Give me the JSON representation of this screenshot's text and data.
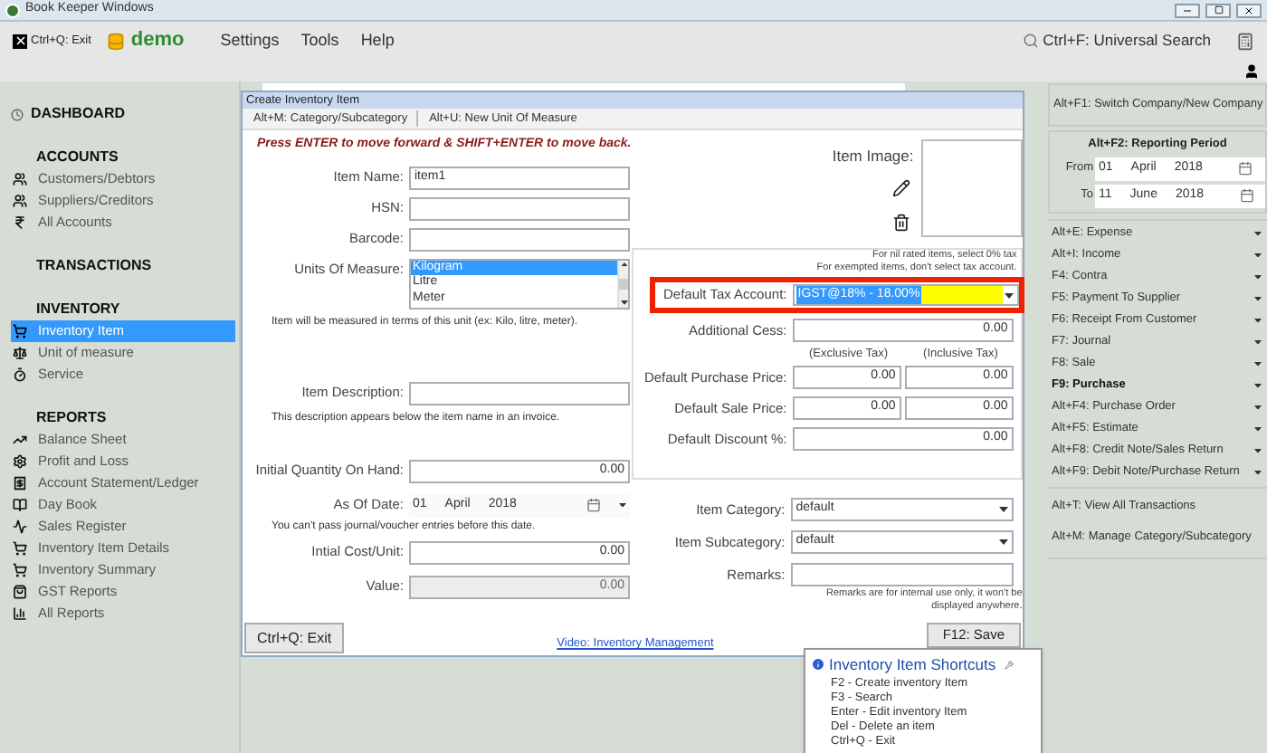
{
  "window": {
    "title": "Book Keeper Windows"
  },
  "menu_bar": {
    "exit": "Ctrl+Q: Exit",
    "company": "demo",
    "items": [
      "Settings",
      "Tools",
      "Help"
    ],
    "search": "Ctrl+F: Universal Search"
  },
  "sidebar": {
    "dashboard": "DASHBOARD",
    "sections": [
      {
        "title": "ACCOUNTS",
        "items": [
          {
            "label": "Customers/Debtors",
            "selected": false
          },
          {
            "label": "Suppliers/Creditors",
            "selected": false
          },
          {
            "label": "All Accounts",
            "selected": false
          }
        ]
      },
      {
        "title": "TRANSACTIONS"
      },
      {
        "title": "INVENTORY",
        "items": [
          {
            "label": "Inventory Item",
            "selected": true
          },
          {
            "label": "Unit of measure",
            "selected": false
          },
          {
            "label": "Service",
            "selected": false
          }
        ]
      },
      {
        "title": "REPORTS",
        "items": [
          {
            "label": "Balance Sheet",
            "selected": false
          },
          {
            "label": "Profit and Loss",
            "selected": false
          },
          {
            "label": "Account Statement/Ledger",
            "selected": false
          },
          {
            "label": "Day Book",
            "selected": false
          },
          {
            "label": "Sales Register",
            "selected": false
          },
          {
            "label": "Inventory Item Details",
            "selected": false
          },
          {
            "label": "Inventory Summary",
            "selected": false
          },
          {
            "label": "GST Reports",
            "selected": false
          },
          {
            "label": "All Reports",
            "selected": false
          }
        ]
      }
    ]
  },
  "dialog": {
    "title": "Create Inventory Item",
    "toolbar": [
      "Alt+M: Category/Subcategory",
      "Alt+U: New Unit Of Measure"
    ],
    "hint": "Press ENTER to move forward & SHIFT+ENTER to move back.",
    "item_name": {
      "label": "Item Name:",
      "value": "item1"
    },
    "hsn": {
      "label": "HSN:"
    },
    "barcode": {
      "label": "Barcode:"
    },
    "units": {
      "label": "Units Of Measure:",
      "options": [
        {
          "label": "Kilogram",
          "selected": true
        },
        {
          "label": "Litre",
          "selected": false
        },
        {
          "label": "Meter",
          "selected": false
        }
      ],
      "note": "Item will be measured in terms of this unit (ex: Kilo, litre, meter)."
    },
    "description": {
      "label": "Item Description:",
      "note": "This description appears below the item name in an invoice."
    },
    "initial_quantity": {
      "label": "Initial Quantity On Hand:",
      "value": "0.00"
    },
    "as_of_date": {
      "label": "As Of Date:",
      "day": "01",
      "month": "April",
      "year": "2018",
      "note": "You can't pass journal/voucher entries before this date."
    },
    "initial_cost": {
      "label": "Intial Cost/Unit:",
      "value": "0.00"
    },
    "value": {
      "label": "Value:",
      "value": "0.00",
      "disabled": true
    },
    "item_image": {
      "label": "Item Image:"
    },
    "tax": {
      "notes": [
        "For nil rated items, select 0% tax",
        "For exempted items, don't select tax account."
      ],
      "label": "Default Tax Account:",
      "value": "IGST@18% - 18.00%",
      "highlighted": true
    },
    "additional_cess": {
      "label": "Additional Cess:",
      "value": "0.00"
    },
    "price_headers": [
      "(Exclusive Tax)",
      "(Inclusive Tax)"
    ],
    "purchase_price": {
      "label": "Default Purchase Price:",
      "values": [
        "0.00",
        "0.00"
      ]
    },
    "sale_price": {
      "label": "Default Sale Price:",
      "values": [
        "0.00",
        "0.00"
      ]
    },
    "discount": {
      "label": "Default Discount %:",
      "value": "0.00"
    },
    "category": {
      "label": "Item Category:",
      "value": "default"
    },
    "subcategory": {
      "label": "Item Subcategory:",
      "value": "default"
    },
    "remarks": {
      "label": "Remarks:",
      "note": "Remarks are for internal use only, it won't be displayed anywhere."
    },
    "exit_button": "Ctrl+Q: Exit",
    "video_link": "Video: Inventory Management",
    "save_button": "F12: Save"
  },
  "shortcuts_popup": {
    "title": "Inventory Item Shortcuts",
    "lines": [
      "F2 - Create inventory Item",
      "F3 - Search",
      "Enter - Edit inventory Item",
      "Del - Delete an item",
      "Ctrl+Q - Exit"
    ]
  },
  "right_panel": {
    "switch_company": "Alt+F1: Switch Company/New Company",
    "reporting_period": {
      "title": "Alt+F2: Reporting Period",
      "from": {
        "label": "From",
        "day": "01",
        "month": "April",
        "year": "2018"
      },
      "to": {
        "label": "To",
        "day": "11",
        "month": "June",
        "year": "2018"
      }
    },
    "actions": [
      {
        "label": "Alt+E: Expense",
        "selected": false
      },
      {
        "label": "Alt+I: Income",
        "selected": false
      },
      {
        "label": "F4: Contra",
        "selected": false
      },
      {
        "label": "F5: Payment To Supplier",
        "selected": false
      },
      {
        "label": "F6: Receipt From Customer",
        "selected": false
      },
      {
        "label": "F7: Journal",
        "selected": false
      },
      {
        "label": "F8: Sale",
        "selected": false
      },
      {
        "label": "F9: Purchase",
        "selected": true
      },
      {
        "label": "Alt+F4: Purchase Order",
        "selected": false
      },
      {
        "label": "Alt+F5: Estimate",
        "selected": false
      },
      {
        "label": "Alt+F8: Credit Note/Sales Return",
        "selected": false
      },
      {
        "label": "Alt+F9: Debit Note/Purchase Return",
        "selected": false
      }
    ],
    "links": [
      "Alt+T: View All Transactions",
      "Alt+M: Manage Category/Subcategory"
    ]
  }
}
